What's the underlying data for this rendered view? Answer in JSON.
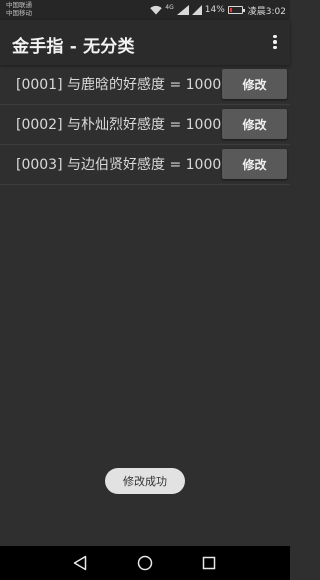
{
  "status_bar": {
    "carrier_1": "中国联通",
    "carrier_2": "中国移动",
    "network_type": "4G",
    "battery_percent": "14%",
    "battery_level": 0.14,
    "time": "凌晨3:02"
  },
  "app_bar": {
    "title": "金手指 - 无分类",
    "menu_icon": "more-vert-icon"
  },
  "cheats": [
    {
      "label": "[0001] 与鹿晗的好感度 = 1000",
      "button": "修改"
    },
    {
      "label": "[0002] 与朴灿烈好感度 = 1000",
      "button": "修改"
    },
    {
      "label": "[0003] 与边伯贤好感度 = 1000",
      "button": "修改"
    }
  ],
  "toast": {
    "message": "修改成功"
  },
  "nav_bar": {
    "back_icon": "back-triangle-icon",
    "home_icon": "home-circle-icon",
    "recents_icon": "recents-square-icon"
  },
  "colors": {
    "background": "#2f2f2f",
    "app_bar": "#2b2b2b",
    "button": "#595959",
    "toast": "#e2e2e2",
    "battery_low": "#e53935"
  }
}
